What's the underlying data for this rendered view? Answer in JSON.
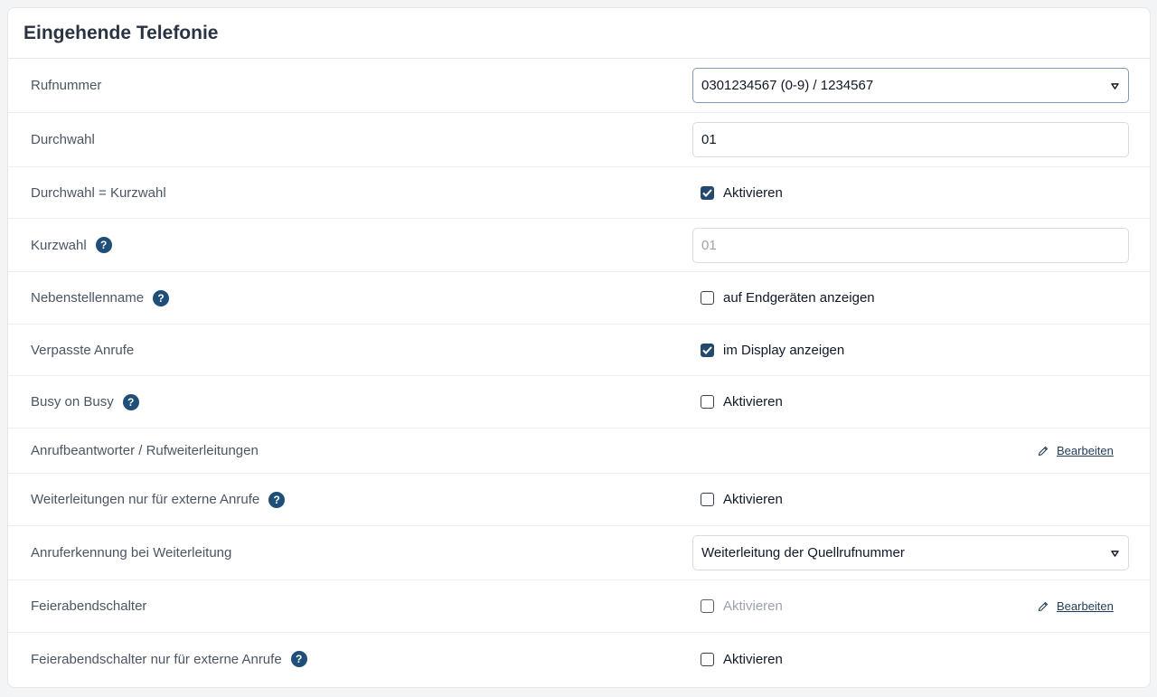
{
  "card": {
    "title": "Eingehende Telefonie"
  },
  "rows": {
    "rufnummer": {
      "label": "Rufnummer",
      "value": "0301234567 (0-9) / 1234567"
    },
    "durchwahl": {
      "label": "Durchwahl",
      "value": "01"
    },
    "durchwahl_kurzwahl": {
      "label": "Durchwahl = Kurzwahl",
      "check_label": "Aktivieren",
      "checked": true
    },
    "kurzwahl": {
      "label": "Kurzwahl",
      "placeholder": "01"
    },
    "nebenstellenname": {
      "label": "Nebenstellenname",
      "check_label": "auf Endgeräten anzeigen",
      "checked": false
    },
    "verpasste_anrufe": {
      "label": "Verpasste Anrufe",
      "check_label": "im Display anzeigen",
      "checked": true
    },
    "busy_on_busy": {
      "label": "Busy on Busy",
      "check_label": "Aktivieren",
      "checked": false
    },
    "anrufbeantworter": {
      "label": "Anrufbeantworter / Rufweiterleitungen",
      "edit_label": "Bearbeiten"
    },
    "weiterleitungen_extern": {
      "label": "Weiterleitungen nur für externe Anrufe",
      "check_label": "Aktivieren",
      "checked": false
    },
    "anruferkennung": {
      "label": "Anruferkennung bei Weiterleitung",
      "value": "Weiterleitung der Quellrufnummer"
    },
    "feierabendschalter": {
      "label": "Feierabendschalter",
      "check_label": "Aktivieren",
      "checked": false,
      "edit_label": "Bearbeiten"
    },
    "feierabendschalter_extern": {
      "label": "Feierabendschalter nur für externe Anrufe",
      "check_label": "Aktivieren",
      "checked": false
    }
  },
  "help_glyph": "?",
  "icons": {
    "help": "question-circle-icon",
    "edit": "pencil-icon",
    "select": "caret-down-icon",
    "check": "checkmark-icon"
  },
  "colors": {
    "accent": "#23496f",
    "help_badge": "#1f4e79",
    "link": "#1f3b5a"
  }
}
